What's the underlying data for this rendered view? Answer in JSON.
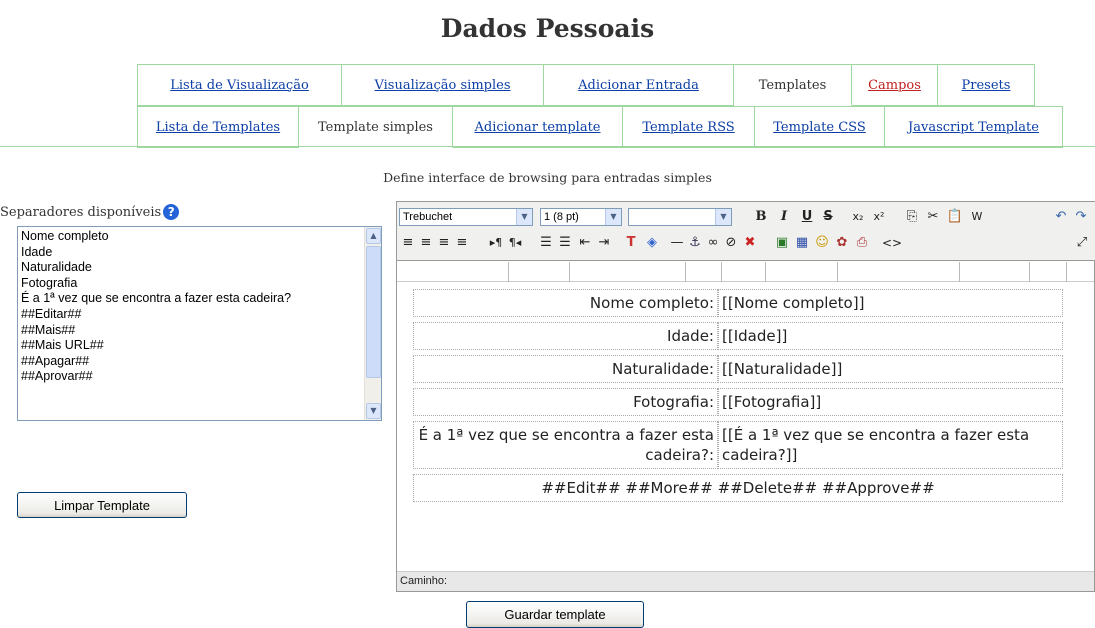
{
  "page": {
    "title": "Dados Pessoais",
    "subtitle": "Define interface de browsing para entradas simples"
  },
  "tabs_row1": [
    {
      "label": "Lista de Visualização",
      "link": true
    },
    {
      "label": "Visualização simples",
      "link": true
    },
    {
      "label": "Adicionar Entrada",
      "link": true
    },
    {
      "label": "Templates",
      "link": false
    },
    {
      "label": "Campos",
      "link": true
    },
    {
      "label": "Presets",
      "link": true
    }
  ],
  "tabs_row2": [
    {
      "label": "Lista de Templates",
      "link": true
    },
    {
      "label": "Template simples",
      "link": false
    },
    {
      "label": "Adicionar template",
      "link": true
    },
    {
      "label": "Template RSS",
      "link": true
    },
    {
      "label": "Template CSS",
      "link": true
    },
    {
      "label": "Javascript Template",
      "link": true
    }
  ],
  "separators": {
    "label": "Separadores disponíveis",
    "items": [
      "Nome completo",
      "Idade",
      "Naturalidade",
      "Fotografia",
      "É a 1ª vez que se encontra a fazer esta cadeira?",
      "##Editar##",
      "##Mais##",
      "##Mais URL##",
      "##Apagar##",
      "##Aprovar##"
    ]
  },
  "buttons": {
    "clear": "Limpar Template",
    "save": "Guardar template"
  },
  "editor": {
    "font": "Trebuchet",
    "size": "1 (8 pt)",
    "format": "",
    "path_label": "Caminho:",
    "rows": [
      {
        "label": "Nome completo:",
        "value": "[[Nome completo]]"
      },
      {
        "label": "Idade:",
        "value": "[[Idade]]"
      },
      {
        "label": "Naturalidade:",
        "value": "[[Naturalidade]]"
      },
      {
        "label": "Fotografia:",
        "value": "[[Fotografia]]"
      },
      {
        "label": "É a 1ª vez que se encontra a fazer esta cadeira?:",
        "value": "[[É a 1ª vez que se encontra a fazer esta cadeira?]]"
      }
    ],
    "footer_row": "##Edit## ##More## ##Delete## ##Approve##"
  },
  "colors": {
    "link": "#0b3ea6",
    "link_alt": "#c02020",
    "tab_border": "#9fd89f"
  }
}
